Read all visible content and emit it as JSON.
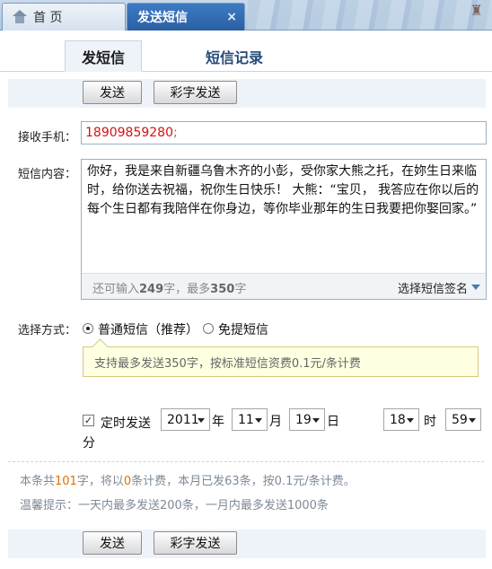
{
  "window_tabs": {
    "home": "首 页",
    "sms": "发送短信",
    "close": "×"
  },
  "subtabs": {
    "send": "发短信",
    "log": "短信记录"
  },
  "buttons": {
    "send": "发送",
    "color_send": "彩字发送"
  },
  "recipient": {
    "label": "接收手机：",
    "value": "18909859280",
    "separator": ";"
  },
  "message": {
    "label": "短信内容：",
    "text": "你好，我是来自新疆乌鲁木齐的小彭，受你家大熊之托，在妳生日来临时，给你送去祝福，祝你生日快乐！ 大熊：“宝贝， 我答应在你以后的每个生日都有我陪伴在你身边，等你毕业那年的生日我要把你娶回家。”",
    "counter_prefix": "还可输入",
    "remaining": "249",
    "counter_mid": "字，最多",
    "max": "350",
    "counter_suffix": "字",
    "signature": "选择短信签名"
  },
  "mode": {
    "label": "选择方式：",
    "option_normal": "普通短信（推荐）",
    "option_free": "免提短信",
    "selected": "普通短信（推荐）",
    "tip": "支持最多发送350字，按标准短信资费0.1元/条计费"
  },
  "schedule": {
    "checked": true,
    "check_mark": "✓",
    "label": "定时发送",
    "year": "2011",
    "year_unit": "年",
    "month": "11",
    "month_unit": "月",
    "day": "19",
    "day_unit": "日",
    "hour": "18",
    "hour_unit": "时",
    "minute": "59",
    "minute_unit": "分"
  },
  "info": {
    "line1_a": "本条共",
    "chars": "101",
    "line1_b": "字，将以",
    "count": "0",
    "line1_c": "条计费，本月已发63条，按0.1元/条计费。",
    "line2": "温馨提示：一天内最多发送200条，一月内最多发送1000条"
  },
  "colors": {
    "accent": "#2a5fa3",
    "highlight": "#e07000",
    "phone": "#d41111",
    "tip_bg": "#ffffe1"
  }
}
